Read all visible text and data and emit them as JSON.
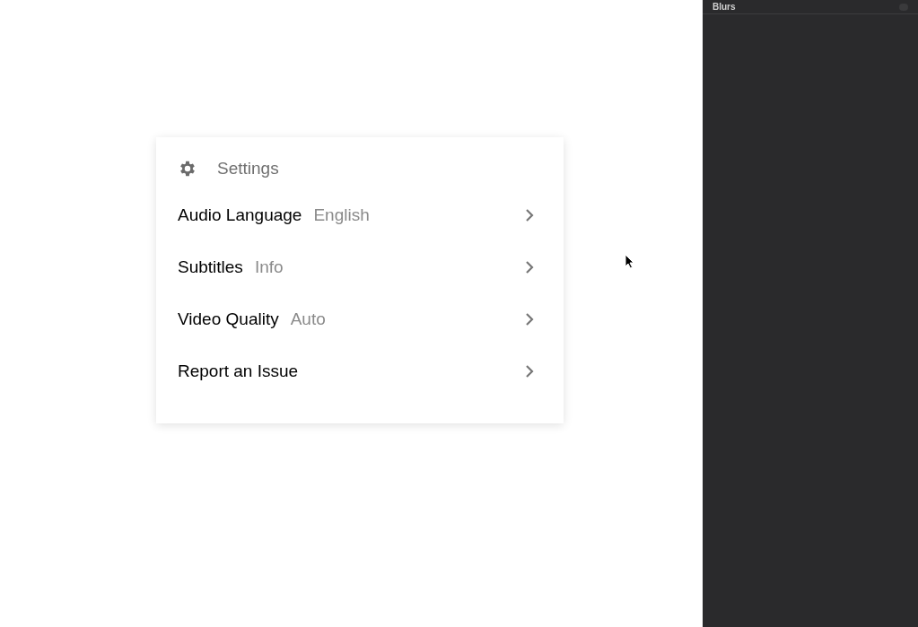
{
  "settings_menu": {
    "title": "Settings",
    "items": [
      {
        "label": "Audio Language",
        "value": "English"
      },
      {
        "label": "Subtitles",
        "value": "Info"
      },
      {
        "label": "Video Quality",
        "value": "Auto"
      },
      {
        "label": "Report an Issue"
      }
    ]
  },
  "side_panel": {
    "title": "Blurs"
  }
}
